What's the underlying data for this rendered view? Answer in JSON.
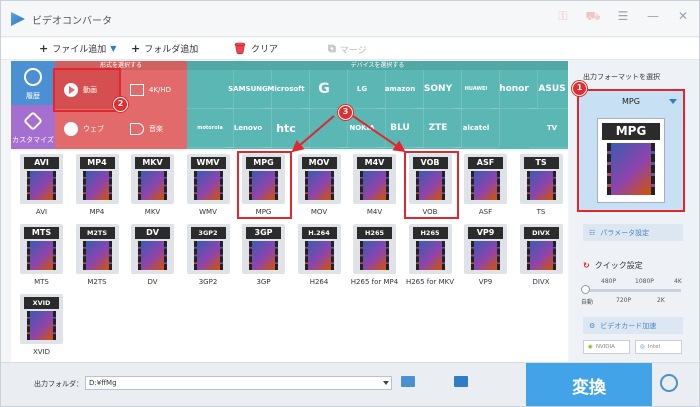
{
  "app": {
    "title": "ビデオコンバータ"
  },
  "toolbar": {
    "add_file": "ファイル追加",
    "add_folder": "フォルダ追加",
    "clear": "クリア",
    "merge": "マージ"
  },
  "sidebar": {
    "history": "履歴",
    "customize": "カスタマイズ"
  },
  "format_panel": {
    "header": "形式を選択する",
    "video": "動画",
    "hd": "4K/HD",
    "web": "ウェブ",
    "audio": "音楽"
  },
  "device_panel": {
    "header": "デバイスを選択する",
    "devices": [
      "",
      "SAMSUNG",
      "Microsoft",
      "G",
      "LG",
      "amazon",
      "SONY",
      "HUAWEI",
      "honor",
      "ASUS",
      "motorola",
      "Lenovo",
      "htc",
      "",
      "NOKIA",
      "BLU",
      "ZTE",
      "alcatel",
      "TV"
    ]
  },
  "annotations": {
    "badge1": "1",
    "badge2": "2",
    "badge3": "3"
  },
  "formats_row1": [
    {
      "cap": "AVI",
      "label": "AVI"
    },
    {
      "cap": "MP4",
      "label": "MP4"
    },
    {
      "cap": "MKV",
      "label": "MKV"
    },
    {
      "cap": "WMV",
      "label": "WMV"
    },
    {
      "cap": "MPG",
      "label": "MPG"
    },
    {
      "cap": "MOV",
      "label": "MOV"
    },
    {
      "cap": "M4V",
      "label": "M4V"
    },
    {
      "cap": "VOB",
      "label": "VOB"
    },
    {
      "cap": "ASF",
      "label": "ASF"
    },
    {
      "cap": "TS",
      "label": "TS"
    }
  ],
  "formats_row2": [
    {
      "cap": "MTS",
      "label": "MTS"
    },
    {
      "cap": "M2TS",
      "label": "M2TS"
    },
    {
      "cap": "DV",
      "label": "DV"
    },
    {
      "cap": "3GP2",
      "label": "3GP2"
    },
    {
      "cap": "3GP",
      "label": "3GP"
    },
    {
      "cap": "H.264",
      "label": "H264"
    },
    {
      "cap": "H265",
      "label": "H265 for MP4"
    },
    {
      "cap": "H265",
      "label": "H265 for MKV"
    },
    {
      "cap": "VP9",
      "label": "VP9"
    },
    {
      "cap": "DIVX",
      "label": "DIVX"
    }
  ],
  "formats_row3": [
    {
      "cap": "XVID",
      "label": "XVID"
    }
  ],
  "right_panel": {
    "title": "出力フォーマットを選択",
    "selected": "MPG",
    "big_cap": "MPG",
    "params": "パラメータ設定",
    "quick": "クイック設定",
    "s480": "480P",
    "s1080": "1080P",
    "s4k": "4K",
    "sauto": "自動",
    "s720": "720P",
    "s2k": "2K",
    "gpu": "ビデオカード加速",
    "nvidia": "NVIDIA",
    "intel": "Intel"
  },
  "bottom": {
    "output_label": "出力フォルダ：",
    "output_path": "D:¥ffMg",
    "convert": "変換"
  }
}
